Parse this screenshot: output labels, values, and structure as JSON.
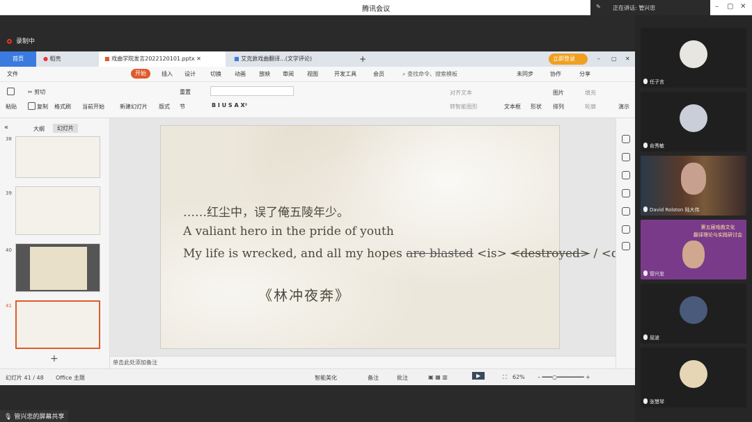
{
  "window_title": "腾讯会议",
  "speaking": "正在讲话: 管兴忠",
  "recording": "录制中",
  "tabs": {
    "home": "首页",
    "docer": "稻壳",
    "file1": "戏曲学院发言2022120101.pptx",
    "file2": "艾克敦戏曲翻译...(文学评论)"
  },
  "menu": {
    "file": "文件",
    "start": "开始",
    "insert": "插入",
    "design": "设计",
    "transition": "切换",
    "animation": "动画",
    "show": "放映",
    "review": "审阅",
    "view": "视图",
    "devtools": "开发工具",
    "member": "会员",
    "search": "查找命令、搜索模板",
    "sync": "未同步",
    "collab": "协作",
    "share": "分享"
  },
  "ribbon": {
    "paste": "粘贴",
    "cut": "剪切",
    "copy": "复制",
    "format_painter": "格式刷",
    "from_current": "当前开始",
    "new_slide": "新建幻灯片",
    "layout": "版式",
    "section": "节",
    "reset": "重置",
    "align_text": "对齐文本",
    "smart_convert": "转智能图形",
    "textbox": "文本框",
    "shape": "形状",
    "arrange": "排列",
    "picture": "图片",
    "fill": "填充",
    "outline": "轮廓",
    "more": "演示"
  },
  "left_pane": {
    "outline": "大纲",
    "slides": "幻灯片",
    "nums": [
      "38",
      "39",
      "40",
      "41"
    ]
  },
  "slide": {
    "line1": "……红尘中，误了俺五陵年少。",
    "line2": "A valiant hero in the pride of youth",
    "line3_a": "My life is wrecked, and all my hopes ",
    "line3_b": "are blasted",
    "line3_c": " <is> ",
    "line3_d": "<destroyed>",
    "line3_e": " / <defeated>.",
    "title": "《林冲夜奔》"
  },
  "notes_placeholder": "单击此处添加备注",
  "status": {
    "slide_no": "幻灯片 41 / 48",
    "theme": "Office 主题",
    "beautify": "智能美化",
    "notes": "备注",
    "comment": "批注",
    "zoom": "62%"
  },
  "participants": [
    {
      "name": "任子言",
      "avatar_color": "#e8e6e0"
    },
    {
      "name": "俞秀敏",
      "avatar_color": "#c9ced8"
    },
    {
      "name": "David Rolston 陆大伟",
      "avatar_color": "#6a4a3a"
    },
    {
      "name": "管兴忠",
      "avatar_color": "#7a3a8a"
    },
    {
      "name": "屈波",
      "avatar_color": "#4a5a7a"
    },
    {
      "name": "张慧琴",
      "avatar_color": "#e6d6b6"
    }
  ],
  "banner_text": [
    "第五届戏曲文化",
    "翻译理论与实践研讨会"
  ],
  "share_text": "管兴忠的屏幕共享",
  "colors": {
    "accent": "#e05a2a",
    "record": "#e33333",
    "slide_text": "#4a4a3a"
  }
}
